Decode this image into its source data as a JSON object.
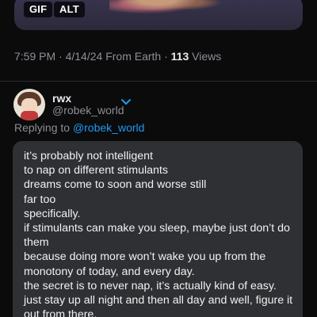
{
  "media": {
    "gif_label": "GIF",
    "alt_label": "ALT"
  },
  "meta": {
    "time": "7:59 PM",
    "date": "4/14/24",
    "source": "From Earth",
    "views_count": "113",
    "views_label": "Views",
    "separator": "·"
  },
  "reply": {
    "name": "rwx",
    "handle": "@robek_world",
    "replying_label": "Replying to",
    "replying_handle": "@robek_world",
    "message": "it’s probably not intelligent\nto nap on different stimulants\ndreams come to soon and worse still\nfar too\nspecifically.\nif stimulants can make you sleep, maybe just don’t do them\nbecause doing more won’t wake you up from the monotony of today, and every day.\nthe secret is to never nap, it’s actually kind of easy. just stay up all night and then all day and well, figure it out from there."
  },
  "colors": {
    "background": "#0b0b0c",
    "bubble": "#2f3033",
    "muted_text": "#8b8f95",
    "link": "#1d9bf0"
  },
  "icons": {
    "chevron": "chevron-down-icon",
    "avatar": "avatar"
  }
}
